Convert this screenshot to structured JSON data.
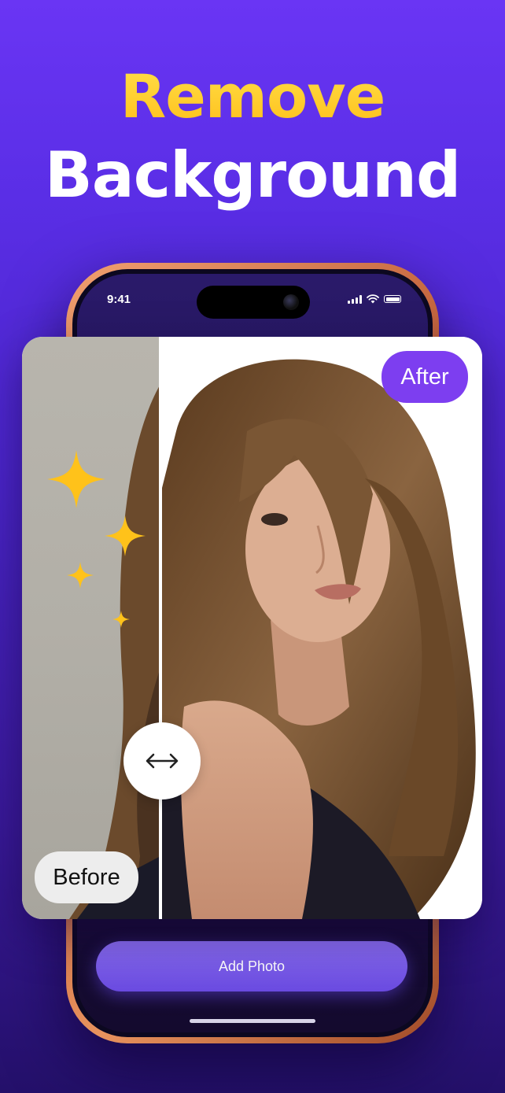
{
  "headline": {
    "line1": "Remove",
    "line2": "Background"
  },
  "status_bar": {
    "time": "9:41",
    "icons": [
      "cellular-signal-icon",
      "wifi-icon",
      "battery-icon"
    ]
  },
  "comparison": {
    "before_label": "Before",
    "after_label": "After",
    "handle_icon": "left-right-arrow-icon",
    "decorations": [
      "sparkle-icon",
      "sparkle-icon",
      "sparkle-icon",
      "sparkle-icon"
    ]
  },
  "actions": {
    "add_photo_label": "Add Photo"
  },
  "colors": {
    "background_top": "#6a35f4",
    "background_bottom": "#24106a",
    "headline_accent": "#ffcf2a",
    "after_pill": "#7d3ef0",
    "button": "#6a4ae0",
    "phone_frame": "#c0603a",
    "sparkle": "#ffc21a"
  }
}
